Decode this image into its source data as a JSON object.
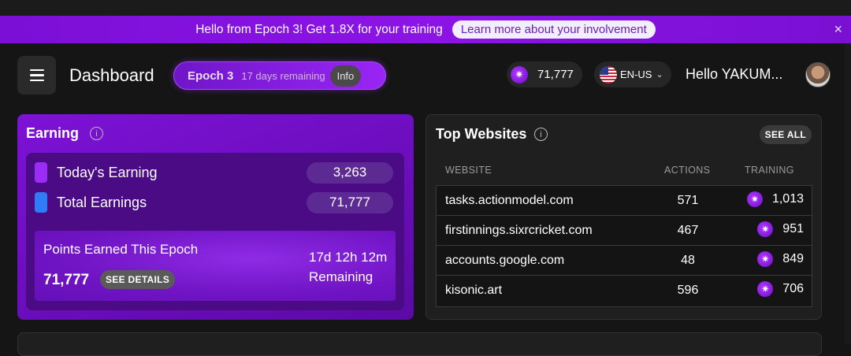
{
  "banner": {
    "message": "Hello from Epoch 3! Get 1.8X for your training",
    "link": "Learn more about your involvement",
    "close": "×"
  },
  "header": {
    "title": "Dashboard",
    "epoch_name": "Epoch 3",
    "epoch_remaining": "17 days remaining",
    "info_label": "Info",
    "points": "71,777",
    "language": "EN-US",
    "greeting": "Hello YAKUM..."
  },
  "earning": {
    "title": "Earning",
    "rows": [
      {
        "label": "Today's Earning",
        "value": "3,263",
        "color": "#9b2cf5"
      },
      {
        "label": "Total Earnings",
        "value": "71,777",
        "color": "#2f7cf6"
      }
    ],
    "epoch_box": {
      "label": "Points Earned This Epoch",
      "value": "71,777",
      "details_label": "SEE DETAILS",
      "time": "17d 12h 12m",
      "remaining_label": "Remaining"
    }
  },
  "top_websites": {
    "title": "Top Websites",
    "see_all": "SEE ALL",
    "columns": [
      "WEBSITE",
      "ACTIONS",
      "TRAINING"
    ],
    "rows": [
      {
        "website": "tasks.actionmodel.com",
        "actions": "571",
        "training": "1,013"
      },
      {
        "website": "firstinnings.sixrcricket.com",
        "actions": "467",
        "training": "951"
      },
      {
        "website": "accounts.google.com",
        "actions": "48",
        "training": "849"
      },
      {
        "website": "kisonic.art",
        "actions": "596",
        "training": "706"
      }
    ]
  },
  "colors": {
    "accent": "#7b0fd6",
    "brand_purple": "#9b2cf5",
    "blue": "#2f7cf6"
  }
}
